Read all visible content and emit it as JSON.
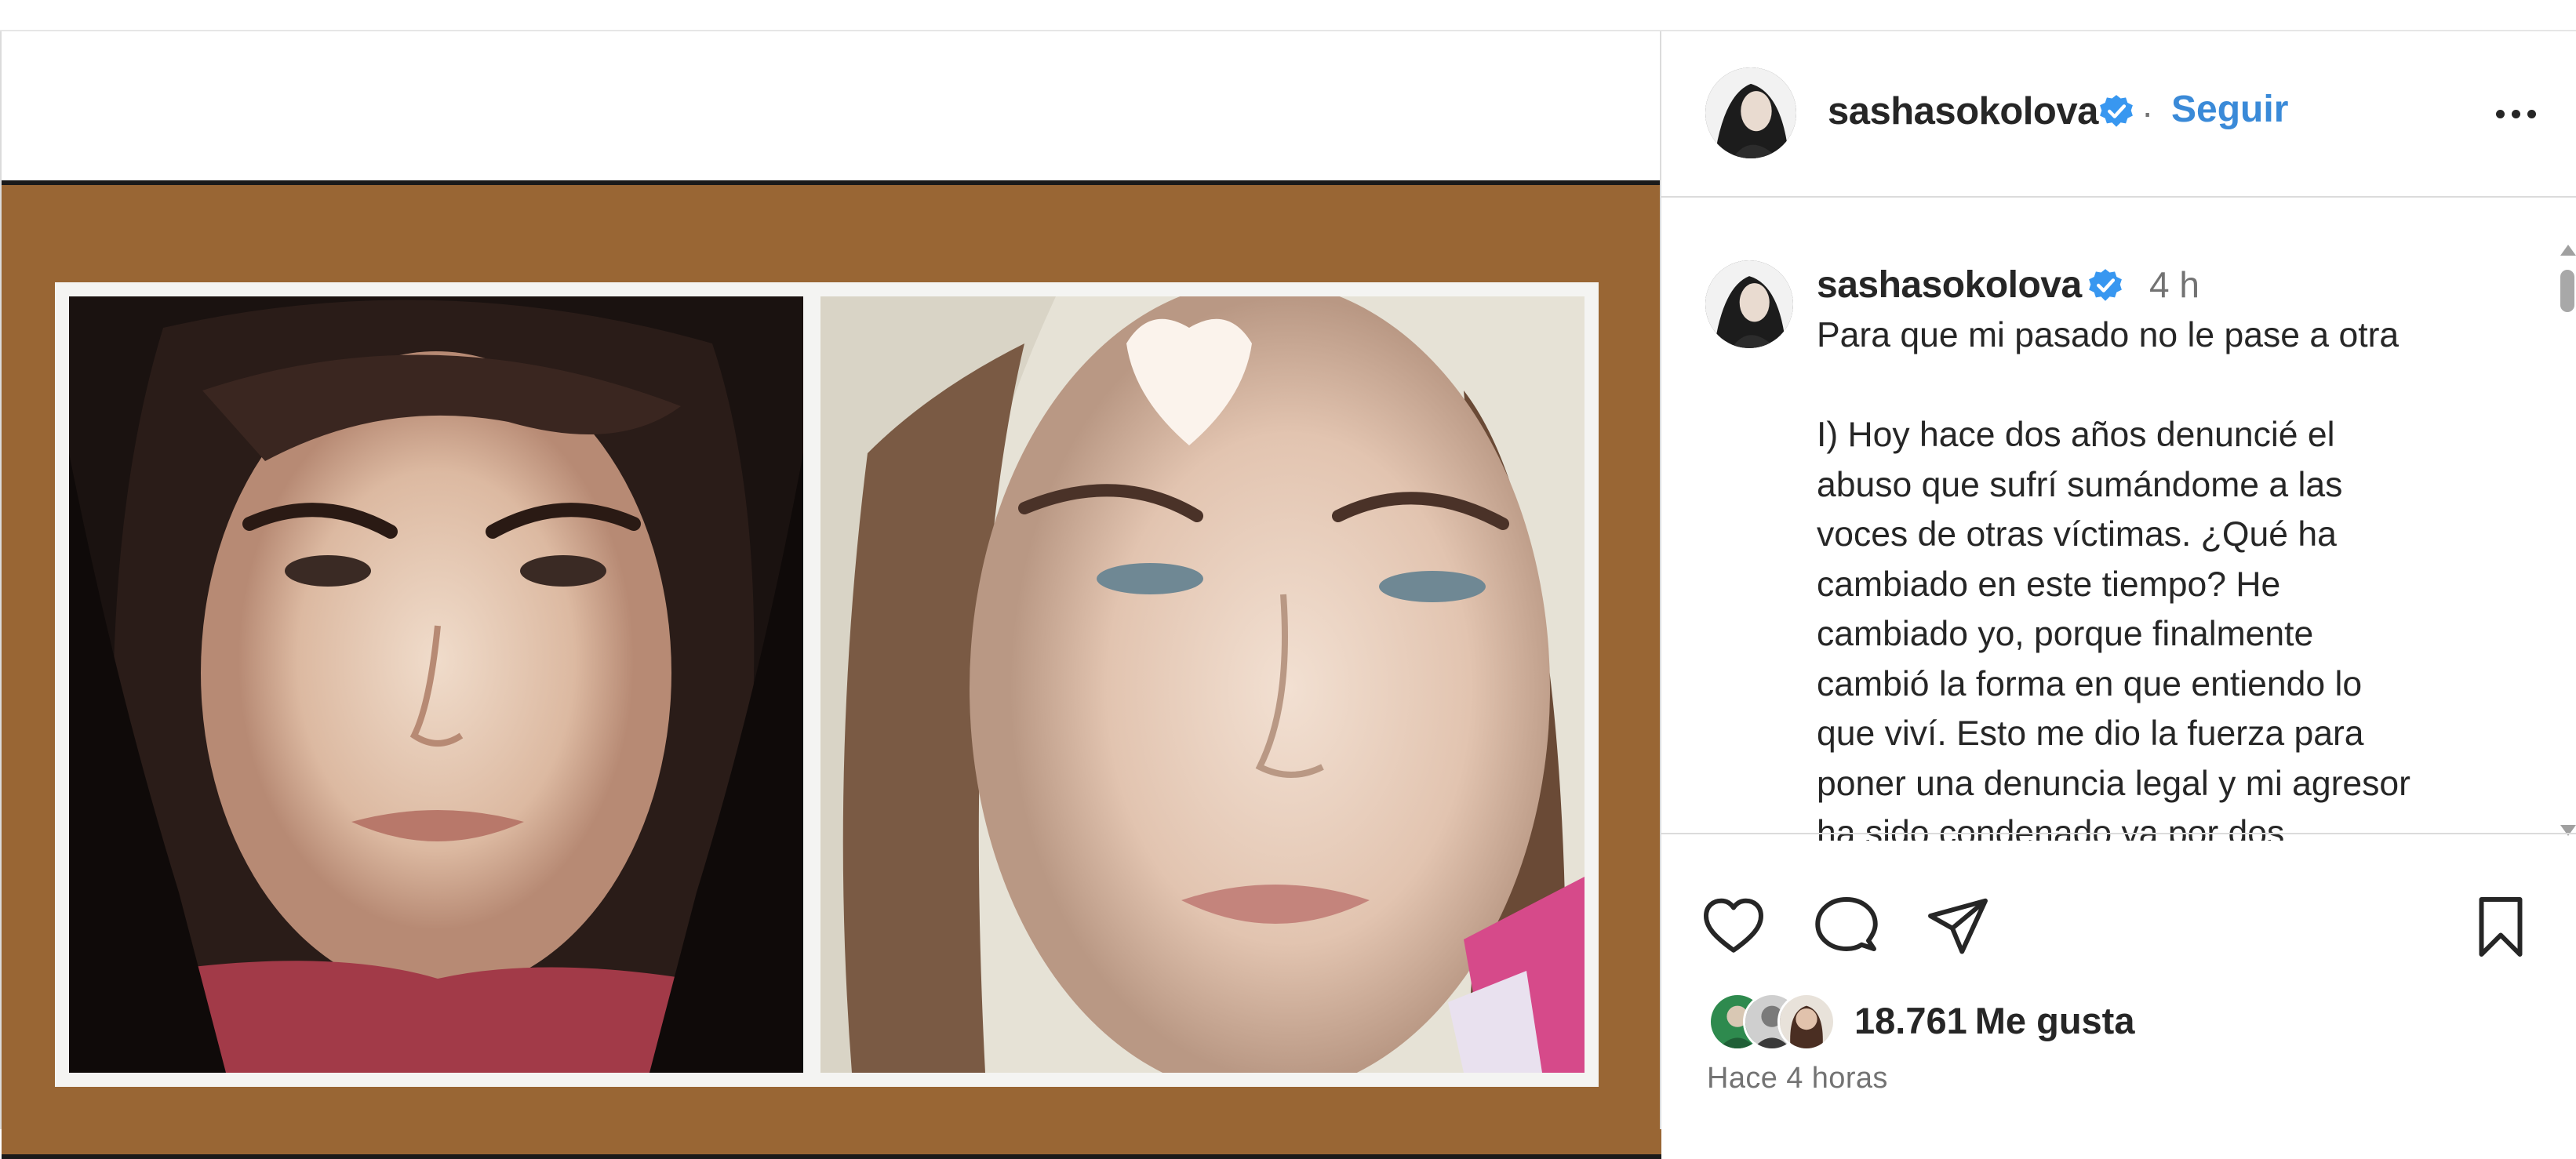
{
  "post": {
    "username": "sashasokolova",
    "follow_label": "Seguir",
    "separator": "·",
    "time_ago": "4 h",
    "caption_lines": [
      "Para que mi pasado no le pase a otra",
      "",
      "I) Hoy hace dos años denuncié el",
      "abuso que sufrí sumándome a las",
      "voces de otras víctimas. ¿Qué ha",
      "cambiado en este tiempo? He",
      "cambiado yo, porque finalmente",
      "cambió la forma en que entiendo lo",
      "que viví. Esto me dio la fuerza para",
      "poner una denuncia legal y mi agresor",
      "ha sido condenado ya por dos"
    ],
    "likes_count": "18.761",
    "likes_label": "Me gusta",
    "posted_label": "Hace 4 horas"
  },
  "icons": {
    "more": "more-options-icon",
    "verified": "verified-badge-icon",
    "like": "heart-outline-icon",
    "comment": "comment-bubble-icon",
    "share": "paper-plane-icon",
    "save": "bookmark-outline-icon"
  },
  "colors": {
    "follow": "#3a8ad8",
    "verified": "#3897f0",
    "frame": "#996634",
    "text": "#262626",
    "muted": "#737373"
  }
}
